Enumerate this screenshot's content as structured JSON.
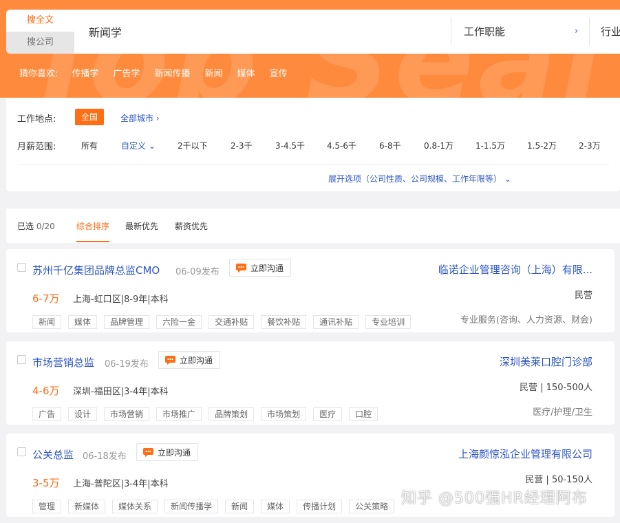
{
  "banner": {
    "watermark_text": "Job Seai"
  },
  "search": {
    "tabs": {
      "fulltext": "搜全文",
      "company": "搜公司"
    },
    "query": "新闻学",
    "function_label": "工作职能",
    "function_chevron": "›",
    "industry_label": "行业"
  },
  "guess": {
    "label": "猜你喜欢:",
    "tags": [
      "传播学",
      "广告学",
      "新闻传播",
      "新闻",
      "媒体",
      "宣传"
    ]
  },
  "filters": {
    "location_label": "工作地点:",
    "location_selected": "全国",
    "all_cities": "全部城市 ›",
    "salary_label": "月薪范围:",
    "salary_options": [
      "所有",
      "自定义 ⌄",
      "2千以下",
      "2-3千",
      "3-4.5千",
      "4.5-6千",
      "6-8千",
      "0.8-1万",
      "1-1.5万",
      "1.5-2万",
      "2-3万"
    ],
    "expand_text": "展开选项（公司性质、公司规模、工作年限等） ⌄"
  },
  "sort": {
    "selected_prefix": "已选 ",
    "selected_count": "0/20",
    "tabs": [
      "综合排序",
      "最新优先",
      "薪资优先"
    ],
    "active_tab": "综合排序"
  },
  "jobs": [
    {
      "title": "苏州千亿集团品牌总监CMO",
      "date": "06-09发布",
      "chat": "立即沟通",
      "salary": "6-7万",
      "meta": "上海-虹口区|8-9年|本科",
      "tags": [
        "新闻",
        "媒体",
        "品牌管理",
        "六险一金",
        "交通补贴",
        "餐饮补贴",
        "通讯补贴",
        "专业培训"
      ],
      "company": "临诺企业管理咨询（上海）有限...",
      "company_type": "民营",
      "industry": "专业服务(咨询、人力资源、财会)"
    },
    {
      "title": "市场营销总监",
      "date": "06-19发布",
      "chat": "立即沟通",
      "salary": "4-6万",
      "meta": "深圳-福田区|3-4年|本科",
      "tags": [
        "广告",
        "设计",
        "市场营销",
        "市场推广",
        "品牌策划",
        "市场策划",
        "医疗",
        "口腔"
      ],
      "company": "深圳美莱口腔门诊部",
      "company_type": "民营 | 150-500人",
      "industry": "医疗/护理/卫生"
    },
    {
      "title": "公关总监",
      "date": "06-18发布",
      "chat": "立即沟通",
      "salary": "3-5万",
      "meta": "上海-普陀区|3-4年|本科",
      "tags": [
        "管理",
        "新媒体",
        "媒体关系",
        "新闻传播学",
        "新闻",
        "媒体",
        "传播计划",
        "公关策略"
      ],
      "company": "上海颜惊泓企业管理有限公司",
      "company_type": "民营 | 50-150人",
      "industry": ""
    }
  ],
  "watermark": "知乎 @500强HR经理阿布",
  "colors": {
    "accent": "#fe6e16",
    "banner": "#fe8b3d",
    "link": "#2b55c3"
  },
  "icons": {
    "chat": "chat-bubble-icon",
    "check": "checkbox-icon"
  }
}
